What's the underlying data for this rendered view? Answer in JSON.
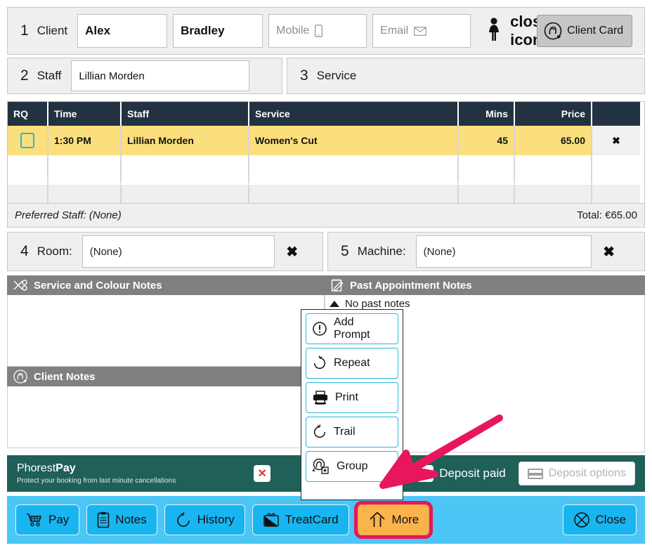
{
  "client": {
    "step": "1",
    "label": "Client",
    "first_name": "Alex",
    "last_name": "Bradley",
    "mobile_placeholder": "Mobile",
    "email_placeholder": "Email",
    "gender_icon": "female-icon",
    "clear_icon": "close-icon",
    "client_card_label": "Client Card"
  },
  "staff": {
    "step": "2",
    "label": "Staff",
    "value": "Lillian Morden"
  },
  "service": {
    "step": "3",
    "label": "Service"
  },
  "table": {
    "columns": [
      "RQ",
      "Time",
      "Staff",
      "Service",
      "Mins",
      "Price",
      ""
    ],
    "rows": [
      {
        "rq": "",
        "time": "1:30 PM",
        "staff": "Lillian Morden",
        "service": "Women's Cut",
        "mins": "45",
        "price": "65.00",
        "delete": "✖"
      }
    ],
    "preferred_staff_label": "Preferred Staff:",
    "preferred_staff_value": "(None)",
    "total": "Total: €65.00"
  },
  "room": {
    "step": "4",
    "label": "Room:",
    "value": "(None)",
    "clear_icon": "close-icon"
  },
  "machine": {
    "step": "5",
    "label": "Machine:",
    "value": "(None)",
    "clear_icon": "close-icon"
  },
  "notes": {
    "service_colour_title": "Service and Colour Notes",
    "past_appointment_title": "Past Appointment Notes",
    "past_appointment_status": "No past notes",
    "client_notes_title": "Client Notes"
  },
  "phorest_pay": {
    "brand_light": "Phorest",
    "brand_bold": "Pay",
    "tagline": "Protect your booking from last minute cancellations",
    "hidden_x": "✕",
    "deposit_paid_label": "Deposit paid",
    "deposit_paid_x": "✕",
    "deposit_options_label": "Deposit options"
  },
  "actions": [
    {
      "label": "Pay",
      "icon": "cart-icon"
    },
    {
      "label": "Notes",
      "icon": "clipboard-icon"
    },
    {
      "label": "History",
      "icon": "undo-arrow-icon"
    },
    {
      "label": "TreatCard",
      "icon": "gift-card-icon"
    },
    {
      "label": "More",
      "icon": "double-up-arrow-icon"
    }
  ],
  "close_button": {
    "label": "Close",
    "icon": "circle-x-icon"
  },
  "more_menu": {
    "items": [
      {
        "label": "Add Prompt",
        "icon": "exclamation-circle-icon"
      },
      {
        "label": "Repeat",
        "icon": "redo-arrow-icon"
      },
      {
        "label": "Print",
        "icon": "printer-icon"
      },
      {
        "label": "Trail",
        "icon": "undo-arrow-icon"
      },
      {
        "label": "Group",
        "icon": "add-person-icon"
      }
    ]
  },
  "colors": {
    "header_dark": "#223240",
    "row_highlight": "#fbdf7c",
    "notes_header_gray": "#808080",
    "phorest_green": "#1f6059",
    "action_bar_blue": "#4cc6f5",
    "button_blue": "#19b5f0",
    "more_orange": "#fbb44b",
    "highlight_pink": "#e8175d",
    "accent_cyan": "#2ab5dd"
  }
}
